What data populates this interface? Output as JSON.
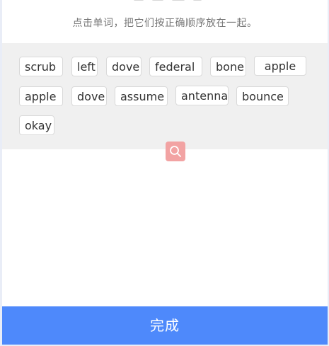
{
  "instruction": "点击单词，把它们按正确顺序放在一起。",
  "words": [
    "scrub",
    "left",
    "dove",
    "federal",
    "bone",
    "apple",
    "apple",
    "dove",
    "assume",
    "antenna",
    "bounce",
    "okay"
  ],
  "search_button": {
    "icon": "search-icon"
  },
  "done_label": "完成",
  "colors": {
    "page_background": "#e9edf7",
    "word_area_background": "#f0f0f0",
    "chip_border": "#d9d9d9",
    "search_button": "#f2a3a3",
    "done_button": "#4e89fb"
  }
}
